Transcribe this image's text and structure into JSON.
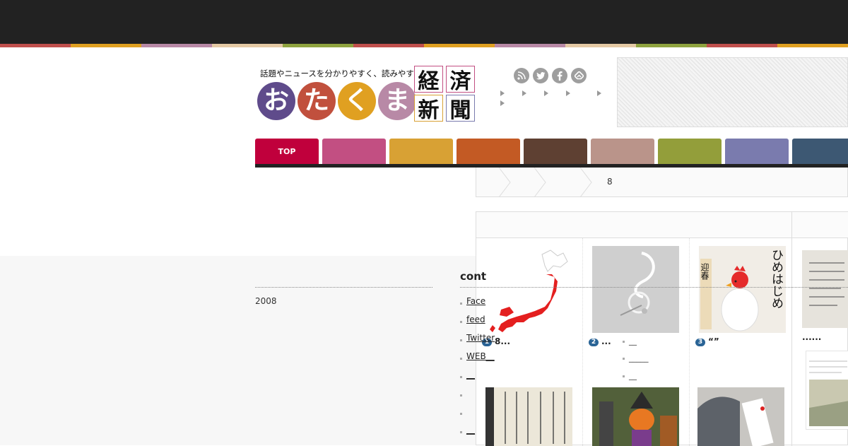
{
  "header": {
    "tagline": "話題やニュースを分かりやすく、読みやすく。",
    "logo_circles": [
      "お",
      "た",
      "く",
      "ま"
    ],
    "logo_circle_colors": [
      "#5f4b8b",
      "#c1503d",
      "#e0a021",
      "#b889a6"
    ],
    "logo_kanji": [
      "経",
      "済",
      "新",
      "聞"
    ],
    "social_icons": [
      "rss-icon",
      "twitter-icon",
      "facebook-icon",
      "feedly-icon"
    ]
  },
  "stripe_colors": [
    "#c0504d",
    "#e0a021",
    "#b889a6",
    "#e4c9a4",
    "#8fa33f",
    "#c0504d",
    "#e0a021",
    "#b889a6",
    "#e4c9a4",
    "#8fa33f",
    "#c0504d",
    "#e0a021"
  ],
  "nav": {
    "tabs": [
      {
        "label": "TOP",
        "color": "#c0003c"
      },
      {
        "label": "",
        "color": "#c24f82"
      },
      {
        "label": "",
        "color": "#d8a134"
      },
      {
        "label": "",
        "color": "#c35a24"
      },
      {
        "label": "",
        "color": "#5e4032"
      },
      {
        "label": "",
        "color": "#ba948a"
      },
      {
        "label": "",
        "color": "#939e3a"
      },
      {
        "label": "",
        "color": "#7a7bae"
      },
      {
        "label": "",
        "color": "#3d5873"
      }
    ]
  },
  "breadcrumb": {
    "current": "8"
  },
  "ranking": {
    "row1": [
      {
        "rank": "1",
        "caption": "8..."
      },
      {
        "rank": "2",
        "caption": "..."
      },
      {
        "rank": "3",
        "caption": "“”"
      }
    ],
    "row1_side_caption": "......",
    "sublinks": [
      "__",
      "_____",
      "__"
    ],
    "chicken_text": "ひめはじめ",
    "chicken_sub": "迎春"
  },
  "footer": {
    "year": "2008",
    "contact_heading": "cont",
    "contact_links": [
      "Face",
      "feed",
      "Twitter",
      "WEB__",
      "__",
      "",
      "",
      "__"
    ]
  }
}
